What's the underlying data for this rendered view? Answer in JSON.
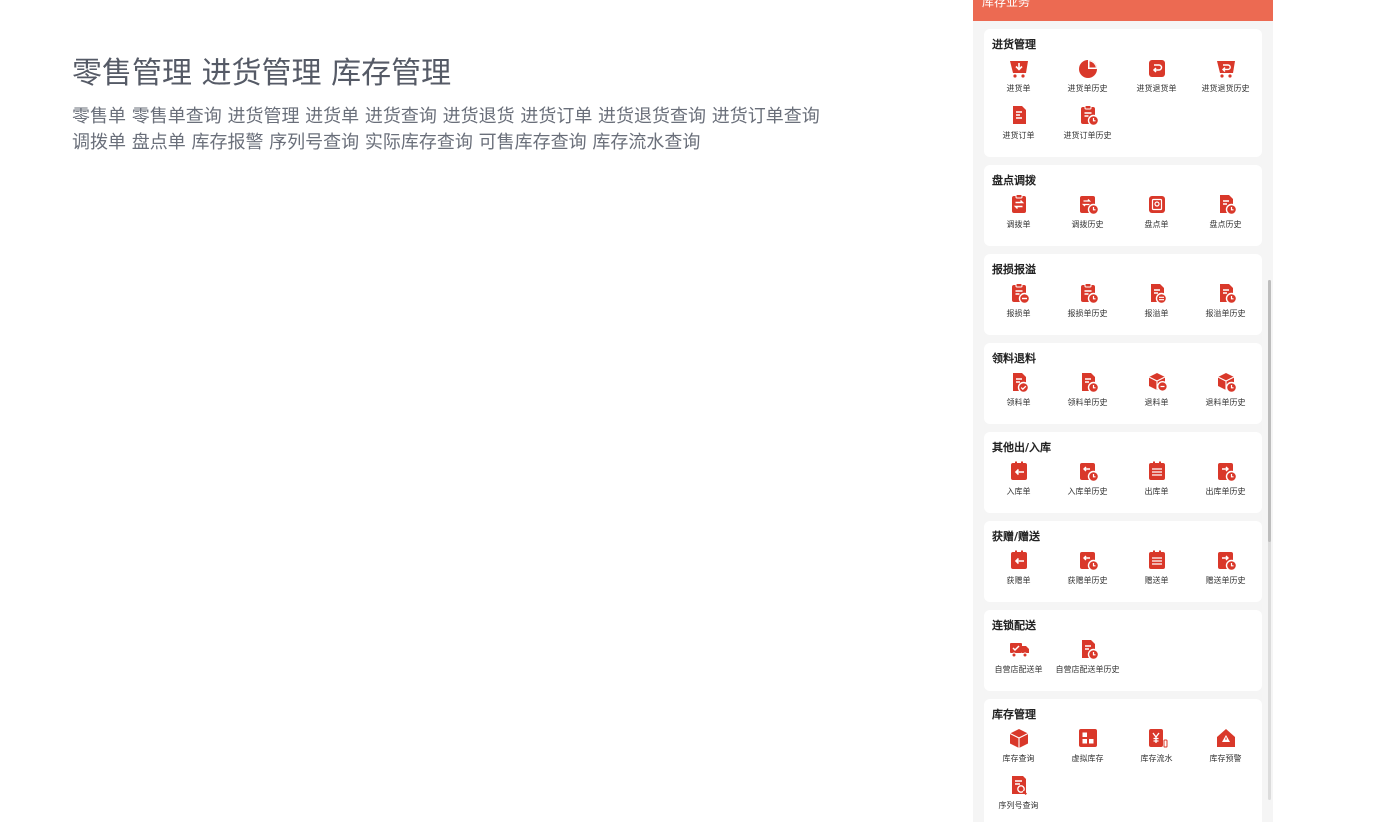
{
  "intro": {
    "title": "零售管理 进货管理 库存管理",
    "desc_line1": "零售单 零售单查询 进货管理 进货单 进货查询 进货退货 进货订单 进货退货查询 进货订单查询",
    "desc_line2": "调拨单 盘点单 库存报警 序列号查询 实际库存查询 可售库存查询 库存流水查询"
  },
  "panel": {
    "header_title": "库存业务",
    "accent_color": "#ec6a52",
    "icon_color": "#d9382a"
  },
  "sections": [
    {
      "title": "进货管理",
      "items": [
        {
          "label": "进货单",
          "icon": "cart-down-icon"
        },
        {
          "label": "进货单历史",
          "icon": "pie-chart-icon"
        },
        {
          "label": "进货退货单",
          "icon": "return-box-icon"
        },
        {
          "label": "进货退货历史",
          "icon": "cart-return-icon"
        },
        {
          "label": "进货订单",
          "icon": "document-icon"
        },
        {
          "label": "进货订单历史",
          "icon": "clipboard-clock-icon"
        }
      ]
    },
    {
      "title": "盘点调拨",
      "items": [
        {
          "label": "调拨单",
          "icon": "clipboard-transfer-icon"
        },
        {
          "label": "调拨历史",
          "icon": "transfer-clock-icon"
        },
        {
          "label": "盘点单",
          "icon": "inventory-check-icon"
        },
        {
          "label": "盘点历史",
          "icon": "document-clock-icon"
        }
      ]
    },
    {
      "title": "报损报溢",
      "items": [
        {
          "label": "报损单",
          "icon": "clipboard-minus-icon"
        },
        {
          "label": "报损单历史",
          "icon": "clipboard-clock-icon"
        },
        {
          "label": "报溢单",
          "icon": "document-plus-icon"
        },
        {
          "label": "报溢单历史",
          "icon": "document-clock-icon"
        }
      ]
    },
    {
      "title": "领料退料",
      "items": [
        {
          "label": "领料单",
          "icon": "document-check-icon"
        },
        {
          "label": "领料单历史",
          "icon": "document-clock-icon"
        },
        {
          "label": "退料单",
          "icon": "box-return-icon"
        },
        {
          "label": "退料单历史",
          "icon": "box-clock-icon"
        }
      ]
    },
    {
      "title": "其他出/入库",
      "items": [
        {
          "label": "入库单",
          "icon": "stock-in-icon"
        },
        {
          "label": "入库单历史",
          "icon": "stock-in-clock-icon"
        },
        {
          "label": "出库单",
          "icon": "stock-out-icon"
        },
        {
          "label": "出库单历史",
          "icon": "stock-out-clock-icon"
        }
      ]
    },
    {
      "title": "获赠/赠送",
      "items": [
        {
          "label": "获赠单",
          "icon": "gift-in-icon"
        },
        {
          "label": "获赠单历史",
          "icon": "gift-in-clock-icon"
        },
        {
          "label": "赠送单",
          "icon": "gift-out-icon"
        },
        {
          "label": "赠送单历史",
          "icon": "gift-out-clock-icon"
        }
      ]
    },
    {
      "title": "连锁配送",
      "items": [
        {
          "label": "自营店配送单",
          "icon": "delivery-truck-icon"
        },
        {
          "label": "自营店配送单历史",
          "icon": "document-clock-icon"
        }
      ]
    },
    {
      "title": "库存管理",
      "items": [
        {
          "label": "库存查询",
          "icon": "box-icon"
        },
        {
          "label": "虚拟库存",
          "icon": "grid-box-icon"
        },
        {
          "label": "库存流水",
          "icon": "yen-flow-icon"
        },
        {
          "label": "库存预警",
          "icon": "warning-house-icon"
        },
        {
          "label": "序列号查询",
          "icon": "document-search-icon"
        }
      ]
    }
  ]
}
